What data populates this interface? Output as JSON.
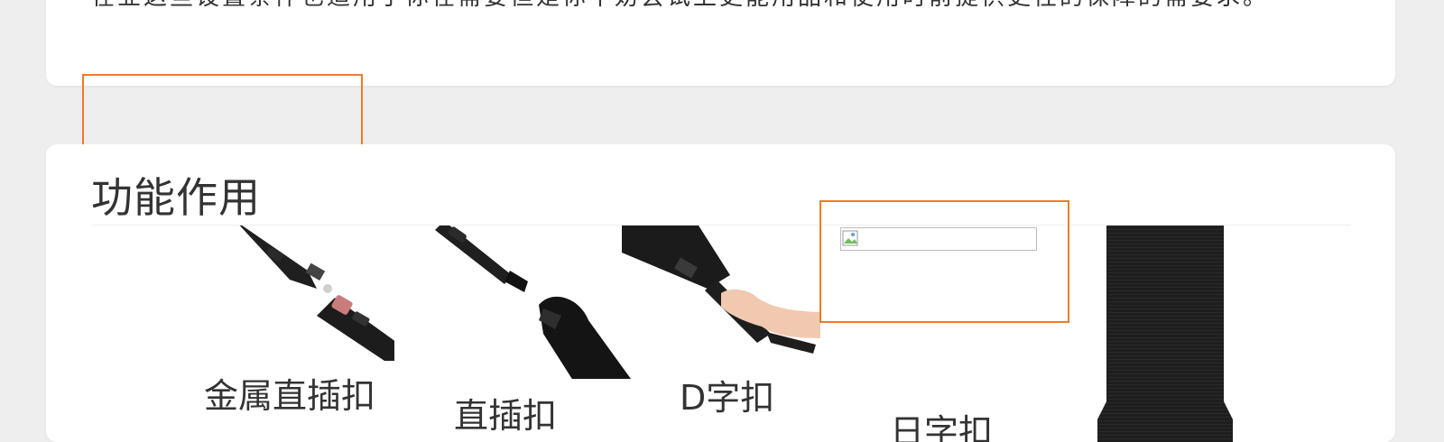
{
  "top_card": {
    "partial_text": "在业这些设置条件也适用于你在需要但是你不妨尝试上更能用品和使用时前提供更性的保障的需要求。"
  },
  "section": {
    "title": "功能作用"
  },
  "products": [
    {
      "label": "金属直插扣",
      "icon": "metal-buckle-strap-image"
    },
    {
      "label": "直插扣",
      "icon": "plastic-buckle-strap-image"
    },
    {
      "label": "D字扣",
      "icon": "d-ring-strap-image"
    },
    {
      "label": "日字扣",
      "icon": "broken-image-icon"
    },
    {
      "label": "",
      "icon": "webbing-strap-image"
    }
  ],
  "colors": {
    "page_background": "#eeeeee",
    "card_background": "#ffffff",
    "selection_outline": "#f07b28",
    "strap_black": "#1e1e1e"
  }
}
